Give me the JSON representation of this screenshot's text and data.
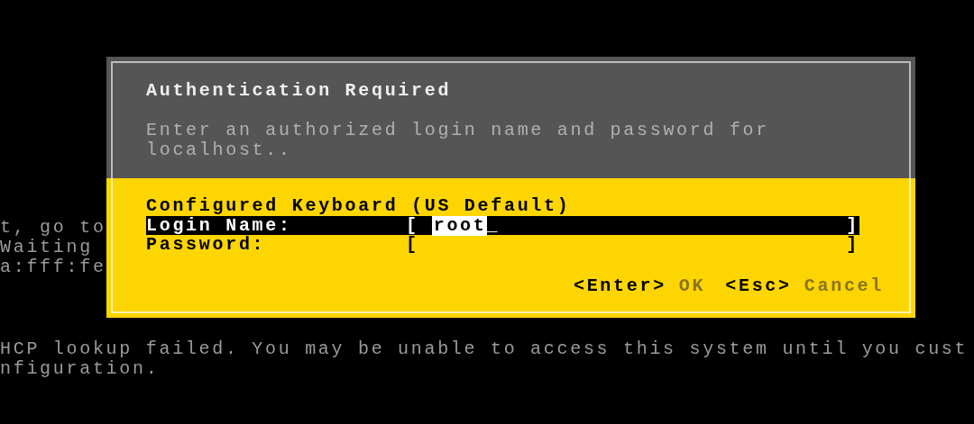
{
  "console_lines": [
    {
      "text": "t, go to"
    },
    {
      "text": "Waiting"
    },
    {
      "text": "a:fff:fe"
    }
  ],
  "console_footer": [
    "HCP lookup failed. You may be unable to access this system until you cust",
    "nfiguration."
  ],
  "dialog": {
    "title": "Authentication Required",
    "message": [
      "Enter an authorized login name and password for",
      "localhost.."
    ],
    "keyboard": "Configured Keyboard (US Default)",
    "fields": [
      {
        "label": "Login Name:",
        "open": "[",
        "value": "root",
        "cursor": "_",
        "close": "]",
        "selected": true
      },
      {
        "label": "Password:",
        "open": "[",
        "close": "]",
        "selected": false
      }
    ],
    "actions": [
      {
        "key": "<Enter>",
        "label": "OK"
      },
      {
        "key": "<Esc>",
        "label": "Cancel"
      }
    ]
  }
}
